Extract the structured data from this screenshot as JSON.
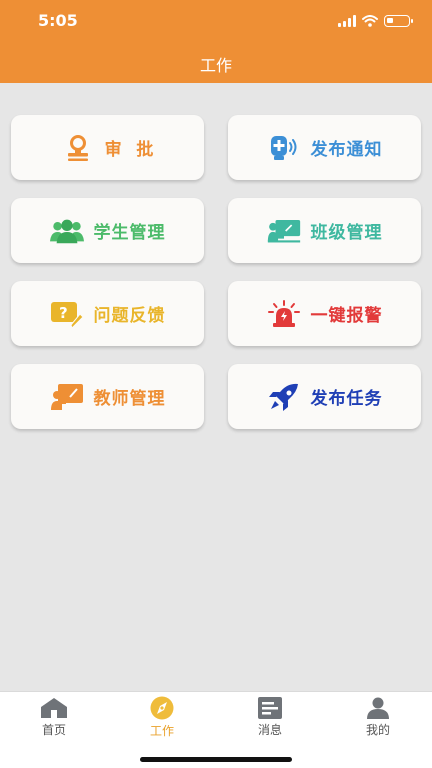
{
  "status_bar": {
    "time": "5:05",
    "battery_level": 0.3
  },
  "header": {
    "title": "工作",
    "background": "#ee8f35"
  },
  "menu": [
    {
      "label": "审  批",
      "icon": "approval-stamp-icon",
      "color": "#ee8f35"
    },
    {
      "label": "发布通知",
      "icon": "announcement-speaker-icon",
      "color": "#3c8fd6"
    },
    {
      "label": "学生管理",
      "icon": "students-group-icon",
      "color": "#4cbb6a"
    },
    {
      "label": "班级管理",
      "icon": "classroom-icon",
      "color": "#3fb8a0"
    },
    {
      "label": "问题反馈",
      "icon": "question-feedback-icon",
      "color": "#e9b52b"
    },
    {
      "label": "一键报警",
      "icon": "alarm-siren-icon",
      "color": "#e23a3a"
    },
    {
      "label": "教师管理",
      "icon": "teacher-board-icon",
      "color": "#ee8f35"
    },
    {
      "label": "发布任务",
      "icon": "rocket-icon",
      "color": "#1f3fb5"
    }
  ],
  "tabbar": {
    "active_color": "#e9a12b",
    "items": [
      {
        "label": "首页",
        "icon": "home-icon"
      },
      {
        "label": "工作",
        "icon": "compass-icon",
        "active": true
      },
      {
        "label": "消息",
        "icon": "message-list-icon"
      },
      {
        "label": "我的",
        "icon": "user-icon"
      }
    ]
  }
}
